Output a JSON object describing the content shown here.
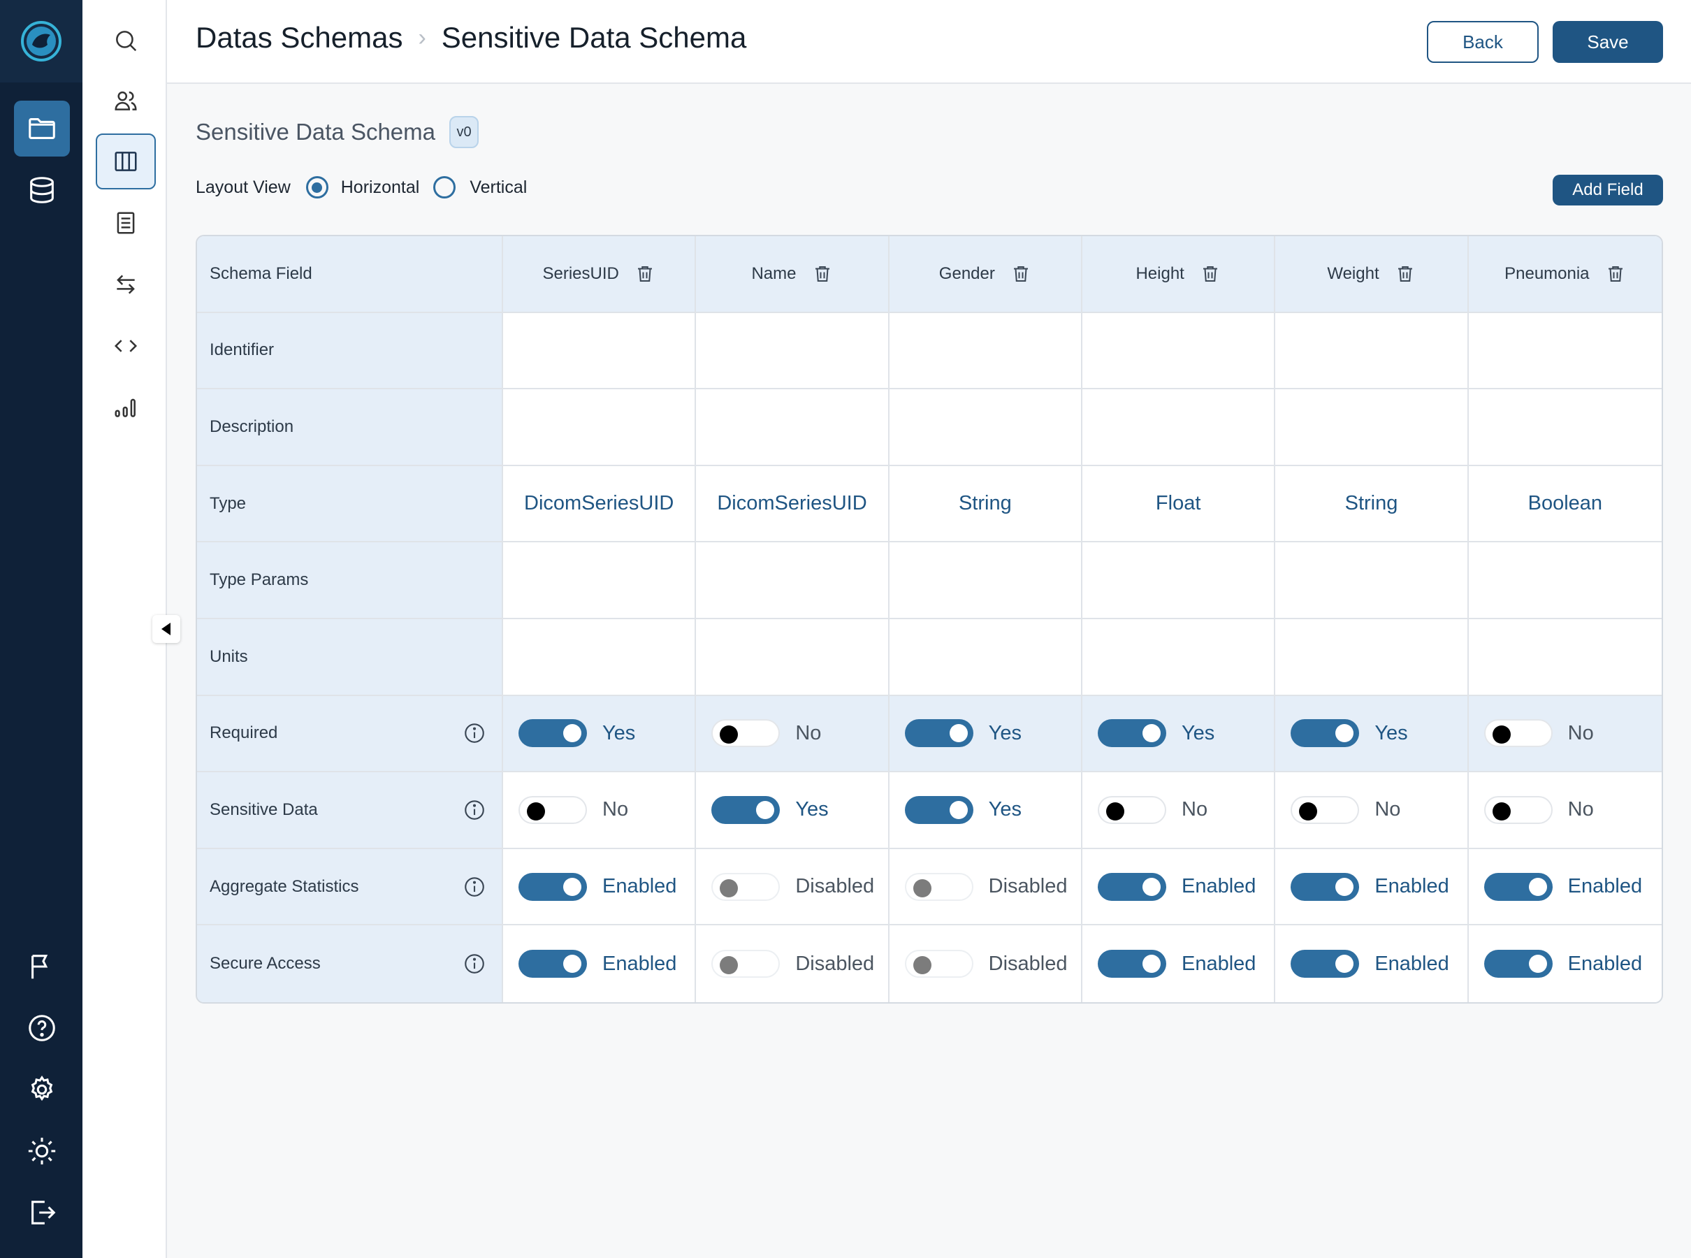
{
  "header": {
    "breadcrumb": [
      "Datas Schemas",
      "Sensitive Data Schema"
    ],
    "back_label": "Back",
    "save_label": "Save"
  },
  "schema": {
    "title": "Sensitive Data Schema",
    "version": "v0"
  },
  "layout_view": {
    "label": "Layout View",
    "options": [
      "Horizontal",
      "Vertical"
    ],
    "selected": "Horizontal"
  },
  "add_field_label": "Add Field",
  "table": {
    "corner": "Schema Field",
    "columns": [
      "SeriesUID",
      "Name",
      "Gender",
      "Height",
      "Weight",
      "Pneumonia"
    ],
    "rows": [
      {
        "label": "Identifier",
        "kind": "text",
        "values": [
          "",
          "",
          "",
          "",
          "",
          ""
        ]
      },
      {
        "label": "Description",
        "kind": "text",
        "values": [
          "",
          "",
          "",
          "",
          "",
          ""
        ]
      },
      {
        "label": "Type",
        "kind": "text",
        "values": [
          "DicomSeriesUID",
          "DicomSeriesUID",
          "String",
          "Float",
          "String",
          "Boolean"
        ]
      },
      {
        "label": "Type Params",
        "kind": "text",
        "values": [
          "",
          "",
          "",
          "",
          "",
          ""
        ]
      },
      {
        "label": "Units",
        "kind": "text",
        "values": [
          "",
          "",
          "",
          "",
          "",
          ""
        ]
      },
      {
        "label": "Required",
        "kind": "toggle",
        "info": true,
        "highlight": true,
        "values": [
          "Yes",
          "No",
          "Yes",
          "Yes",
          "Yes",
          "No"
        ],
        "states": [
          "on",
          "off",
          "on",
          "on",
          "on",
          "off"
        ]
      },
      {
        "label": "Sensitive Data",
        "kind": "toggle",
        "info": true,
        "values": [
          "No",
          "Yes",
          "Yes",
          "No",
          "No",
          "No"
        ],
        "states": [
          "off",
          "on",
          "on",
          "off",
          "off",
          "off"
        ]
      },
      {
        "label": "Aggregate Statistics",
        "kind": "toggle",
        "info": true,
        "values": [
          "Enabled",
          "Disabled",
          "Disabled",
          "Enabled",
          "Enabled",
          "Enabled"
        ],
        "states": [
          "on",
          "dis",
          "dis",
          "on",
          "on",
          "on"
        ]
      },
      {
        "label": "Secure Access",
        "kind": "toggle",
        "info": true,
        "values": [
          "Enabled",
          "Disabled",
          "Disabled",
          "Enabled",
          "Enabled",
          "Enabled"
        ],
        "states": [
          "on",
          "dis",
          "dis",
          "on",
          "on",
          "on"
        ]
      }
    ]
  },
  "rail_icons": {
    "top": [
      "folder-icon",
      "database-icon"
    ],
    "bottom": [
      "flag-icon",
      "help-icon",
      "gear-icon",
      "brightness-icon",
      "logout-icon"
    ]
  },
  "subrail_icons": [
    "search-icon",
    "users-icon",
    "columns-icon",
    "document-icon",
    "transfer-icon",
    "code-icon",
    "bar-chart-icon"
  ],
  "colors": {
    "primary": "#1f5583",
    "accent": "#2e6ea0",
    "rail_bg": "#0f2138",
    "header_cell_bg": "#e5eef8"
  }
}
